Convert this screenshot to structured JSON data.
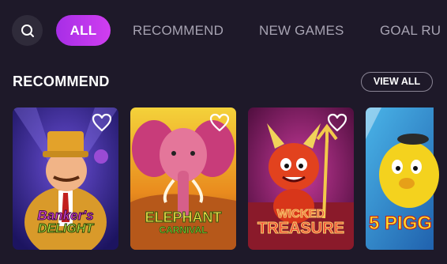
{
  "tabs": [
    {
      "label": "ALL",
      "active": true
    },
    {
      "label": "RECOMMEND",
      "active": false
    },
    {
      "label": "NEW GAMES",
      "active": false
    },
    {
      "label": "GOAL RU",
      "active": false
    }
  ],
  "section": {
    "title": "RECOMMEND",
    "view_all_label": "VIEW ALL"
  },
  "games": [
    {
      "title_line1": "Banker's",
      "title_line2": "DELIGHT",
      "icon": "heart-outline-icon"
    },
    {
      "title_line1": "ELEPHANT",
      "title_line2": "CARNIVAL",
      "icon": "heart-outline-icon"
    },
    {
      "title_line1": "WICKED",
      "title_line2": "TREASURE",
      "icon": "heart-outline-icon"
    },
    {
      "title_line1": "5 PIGG",
      "title_line2": "",
      "icon": "heart-outline-icon"
    }
  ],
  "colors": {
    "background": "#1e1929",
    "accent": "#c23aee",
    "tab_text": "#a7a3b2"
  }
}
